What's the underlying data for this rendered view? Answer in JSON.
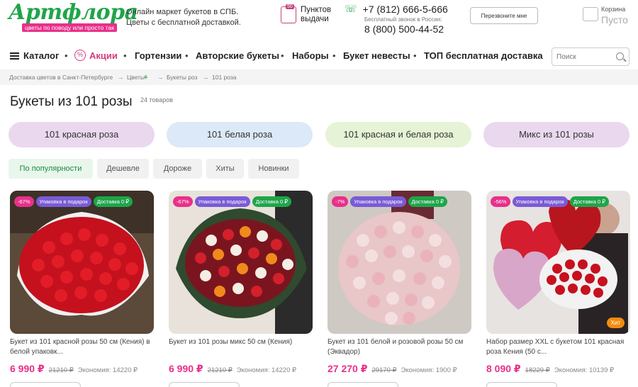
{
  "header": {
    "logo": "Артфлора",
    "logo_tagline": "цветы по поводу или просто так",
    "tagline_line1": "Онлайн маркет букетов в СПБ.",
    "tagline_line2": "Цветы с бесплатной доставкой.",
    "pickup_badge": "50",
    "pickup_label": "Пунктов выдачи",
    "phone": "+7 (812) 666-5-666",
    "free_call_label": "Бесплатный звонок в России:",
    "phone_free": "8 (800) 500-44-52",
    "callback_button": "Перезвоните мне",
    "cart_label": "Корзина",
    "cart_value": "Пусто"
  },
  "nav": {
    "catalog": "Каталог",
    "items": [
      "Акции",
      "Гортензии",
      "Авторские букеты",
      "Наборы",
      "Букет невесты",
      "ТОП бесплатная доставка"
    ],
    "search_placeholder": "Поиск"
  },
  "breadcrumb": [
    "Доставка цветов в Санкт-Петербурге",
    "Цветы",
    "Букеты роз",
    "101 роза"
  ],
  "page": {
    "title": "Букеты из 101 розы",
    "count": "24 товаров"
  },
  "categories": [
    "101 красная роза",
    "101 белая роза",
    "101 красная и белая роза",
    "Микс из 101 розы"
  ],
  "sort": [
    "По популярности",
    "Дешевле",
    "Дороже",
    "Хиты",
    "Новинки"
  ],
  "badges": {
    "gift": "Упаковка в подарок",
    "delivery": "Доставка 0 ₽",
    "hit": "Хит"
  },
  "products": [
    {
      "discount": "-67%",
      "name": "Букет из 101 красной розы 50 см (Кения) в белой упаковк...",
      "price": "6 990 ₽",
      "old_price": "21210 ₽",
      "economy": "Экономия: 14220 ₽"
    },
    {
      "discount": "-67%",
      "name": "Букет из 101 розы микс 50 см (Кения)",
      "price": "6 990 ₽",
      "old_price": "21210 ₽",
      "economy": "Экономия: 14220 ₽"
    },
    {
      "discount": "-7%",
      "name": "Букет из 101 белой и розовой розы 50 см (Эквадор)",
      "price": "27 270 ₽",
      "old_price": "29170 ₽",
      "economy": "Экономия: 1900 ₽"
    },
    {
      "discount": "-56%",
      "name": "Набор размер XXL с букетом 101 красная роза Кения (50 с...",
      "price": "8 090 ₽",
      "old_price": "18229 ₽",
      "economy": "Экономия: 10139 ₽"
    }
  ],
  "colors": {
    "brand_green": "#1fa54a",
    "accent_pink": "#e8308a",
    "gift_purple": "#7a5bd6",
    "hit_orange": "#f28c0f"
  }
}
